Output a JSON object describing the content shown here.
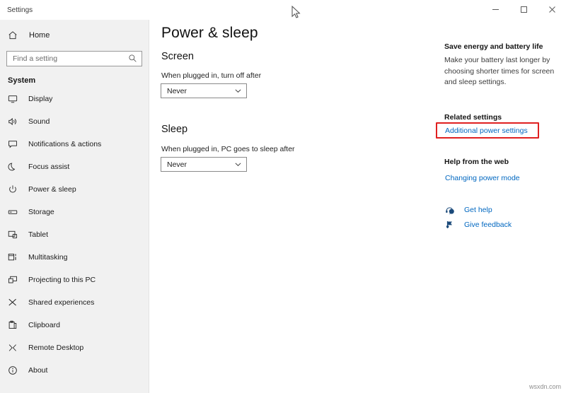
{
  "window": {
    "app_title": "Settings",
    "controls": [
      {
        "name": "minimize",
        "glyph": "minimize-icon"
      },
      {
        "name": "maximize",
        "glyph": "maximize-icon"
      },
      {
        "name": "close",
        "glyph": "close-icon"
      }
    ]
  },
  "sidebar": {
    "home_label": "Home",
    "home_icon": "home-icon",
    "search": {
      "placeholder": "Find a setting",
      "value": "",
      "icon": "search-icon"
    },
    "group_title": "System",
    "items": [
      {
        "label": "Display",
        "icon": "monitor-icon"
      },
      {
        "label": "Sound",
        "icon": "speaker-icon"
      },
      {
        "label": "Notifications & actions",
        "icon": "notification-icon"
      },
      {
        "label": "Focus assist",
        "icon": "moon-icon"
      },
      {
        "label": "Power & sleep",
        "icon": "power-icon"
      },
      {
        "label": "Storage",
        "icon": "storage-icon"
      },
      {
        "label": "Tablet",
        "icon": "tablet-icon"
      },
      {
        "label": "Multitasking",
        "icon": "multitasking-icon"
      },
      {
        "label": "Projecting to this PC",
        "icon": "projecting-icon"
      },
      {
        "label": "Shared experiences",
        "icon": "shared-icon"
      },
      {
        "label": "Clipboard",
        "icon": "clipboard-icon"
      },
      {
        "label": "Remote Desktop",
        "icon": "remote-desktop-icon"
      },
      {
        "label": "About",
        "icon": "info-icon"
      }
    ]
  },
  "main": {
    "page_title": "Power & sleep",
    "screen": {
      "heading": "Screen",
      "field_label": "When plugged in, turn off after",
      "dropdown_value": "Never"
    },
    "sleep": {
      "heading": "Sleep",
      "field_label": "When plugged in, PC goes to sleep after",
      "dropdown_value": "Never"
    }
  },
  "rail": {
    "save_energy_heading": "Save energy and battery life",
    "save_energy_body": "Make your battery last longer by choosing shorter times for screen and sleep settings.",
    "related_settings_heading": "Related settings",
    "additional_power_settings_link": "Additional power settings",
    "help_from_web_heading": "Help from the web",
    "changing_power_mode_link": "Changing power mode",
    "get_help_label": "Get help",
    "get_help_icon": "headset-icon",
    "give_feedback_label": "Give feedback",
    "give_feedback_icon": "feedback-icon",
    "highlight_color": "#e02020",
    "link_color": "#0067c0"
  },
  "watermark": "wsxdn.com"
}
